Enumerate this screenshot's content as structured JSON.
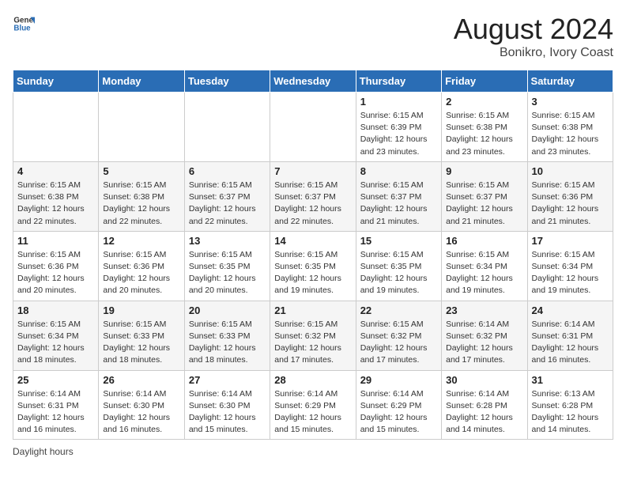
{
  "header": {
    "logo_general": "General",
    "logo_blue": "Blue",
    "month_year": "August 2024",
    "location": "Bonikro, Ivory Coast"
  },
  "weekdays": [
    "Sunday",
    "Monday",
    "Tuesday",
    "Wednesday",
    "Thursday",
    "Friday",
    "Saturday"
  ],
  "weeks": [
    [
      {
        "day": "",
        "info": ""
      },
      {
        "day": "",
        "info": ""
      },
      {
        "day": "",
        "info": ""
      },
      {
        "day": "",
        "info": ""
      },
      {
        "day": "1",
        "info": "Sunrise: 6:15 AM\nSunset: 6:39 PM\nDaylight: 12 hours\nand 23 minutes."
      },
      {
        "day": "2",
        "info": "Sunrise: 6:15 AM\nSunset: 6:38 PM\nDaylight: 12 hours\nand 23 minutes."
      },
      {
        "day": "3",
        "info": "Sunrise: 6:15 AM\nSunset: 6:38 PM\nDaylight: 12 hours\nand 23 minutes."
      }
    ],
    [
      {
        "day": "4",
        "info": "Sunrise: 6:15 AM\nSunset: 6:38 PM\nDaylight: 12 hours\nand 22 minutes."
      },
      {
        "day": "5",
        "info": "Sunrise: 6:15 AM\nSunset: 6:38 PM\nDaylight: 12 hours\nand 22 minutes."
      },
      {
        "day": "6",
        "info": "Sunrise: 6:15 AM\nSunset: 6:37 PM\nDaylight: 12 hours\nand 22 minutes."
      },
      {
        "day": "7",
        "info": "Sunrise: 6:15 AM\nSunset: 6:37 PM\nDaylight: 12 hours\nand 22 minutes."
      },
      {
        "day": "8",
        "info": "Sunrise: 6:15 AM\nSunset: 6:37 PM\nDaylight: 12 hours\nand 21 minutes."
      },
      {
        "day": "9",
        "info": "Sunrise: 6:15 AM\nSunset: 6:37 PM\nDaylight: 12 hours\nand 21 minutes."
      },
      {
        "day": "10",
        "info": "Sunrise: 6:15 AM\nSunset: 6:36 PM\nDaylight: 12 hours\nand 21 minutes."
      }
    ],
    [
      {
        "day": "11",
        "info": "Sunrise: 6:15 AM\nSunset: 6:36 PM\nDaylight: 12 hours\nand 20 minutes."
      },
      {
        "day": "12",
        "info": "Sunrise: 6:15 AM\nSunset: 6:36 PM\nDaylight: 12 hours\nand 20 minutes."
      },
      {
        "day": "13",
        "info": "Sunrise: 6:15 AM\nSunset: 6:35 PM\nDaylight: 12 hours\nand 20 minutes."
      },
      {
        "day": "14",
        "info": "Sunrise: 6:15 AM\nSunset: 6:35 PM\nDaylight: 12 hours\nand 19 minutes."
      },
      {
        "day": "15",
        "info": "Sunrise: 6:15 AM\nSunset: 6:35 PM\nDaylight: 12 hours\nand 19 minutes."
      },
      {
        "day": "16",
        "info": "Sunrise: 6:15 AM\nSunset: 6:34 PM\nDaylight: 12 hours\nand 19 minutes."
      },
      {
        "day": "17",
        "info": "Sunrise: 6:15 AM\nSunset: 6:34 PM\nDaylight: 12 hours\nand 19 minutes."
      }
    ],
    [
      {
        "day": "18",
        "info": "Sunrise: 6:15 AM\nSunset: 6:34 PM\nDaylight: 12 hours\nand 18 minutes."
      },
      {
        "day": "19",
        "info": "Sunrise: 6:15 AM\nSunset: 6:33 PM\nDaylight: 12 hours\nand 18 minutes."
      },
      {
        "day": "20",
        "info": "Sunrise: 6:15 AM\nSunset: 6:33 PM\nDaylight: 12 hours\nand 18 minutes."
      },
      {
        "day": "21",
        "info": "Sunrise: 6:15 AM\nSunset: 6:32 PM\nDaylight: 12 hours\nand 17 minutes."
      },
      {
        "day": "22",
        "info": "Sunrise: 6:15 AM\nSunset: 6:32 PM\nDaylight: 12 hours\nand 17 minutes."
      },
      {
        "day": "23",
        "info": "Sunrise: 6:14 AM\nSunset: 6:32 PM\nDaylight: 12 hours\nand 17 minutes."
      },
      {
        "day": "24",
        "info": "Sunrise: 6:14 AM\nSunset: 6:31 PM\nDaylight: 12 hours\nand 16 minutes."
      }
    ],
    [
      {
        "day": "25",
        "info": "Sunrise: 6:14 AM\nSunset: 6:31 PM\nDaylight: 12 hours\nand 16 minutes."
      },
      {
        "day": "26",
        "info": "Sunrise: 6:14 AM\nSunset: 6:30 PM\nDaylight: 12 hours\nand 16 minutes."
      },
      {
        "day": "27",
        "info": "Sunrise: 6:14 AM\nSunset: 6:30 PM\nDaylight: 12 hours\nand 15 minutes."
      },
      {
        "day": "28",
        "info": "Sunrise: 6:14 AM\nSunset: 6:29 PM\nDaylight: 12 hours\nand 15 minutes."
      },
      {
        "day": "29",
        "info": "Sunrise: 6:14 AM\nSunset: 6:29 PM\nDaylight: 12 hours\nand 15 minutes."
      },
      {
        "day": "30",
        "info": "Sunrise: 6:14 AM\nSunset: 6:28 PM\nDaylight: 12 hours\nand 14 minutes."
      },
      {
        "day": "31",
        "info": "Sunrise: 6:13 AM\nSunset: 6:28 PM\nDaylight: 12 hours\nand 14 minutes."
      }
    ]
  ],
  "footer": {
    "label": "Daylight hours"
  }
}
